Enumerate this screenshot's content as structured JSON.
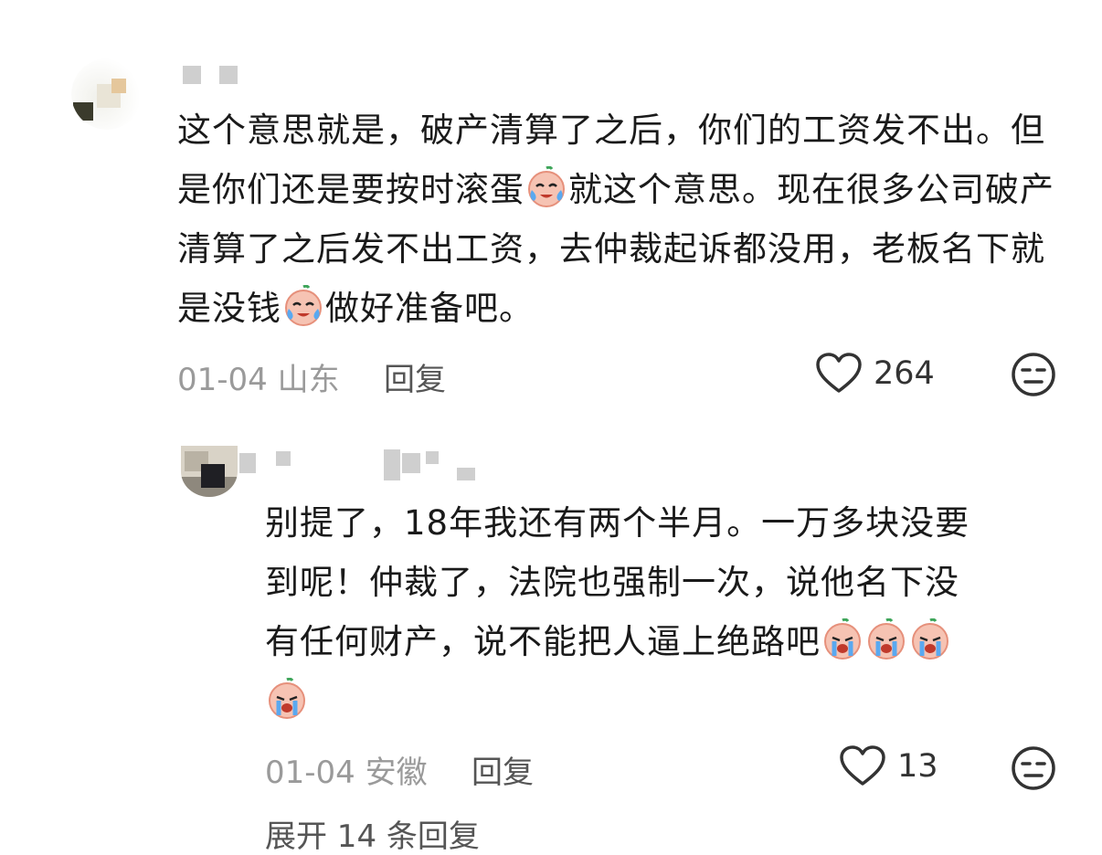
{
  "comment": {
    "text_segments": [
      "这个意思就是，破产清算了之后，你们的工资发不出。但是你们还是要按时滚蛋",
      "就这个意思。现在很多公司破产清算了之后发不出工资，去仲裁起诉都没用，老板名下就是没钱",
      "做好准备吧。"
    ],
    "date": "01-04",
    "location": "山东",
    "reply_label": "回复",
    "like_count": "264",
    "emoji_icon": "crying-face-emoji-icon"
  },
  "reply": {
    "text_line1": "别提了，18年我还有两个半月。一万多块没要",
    "text_line2": "到呢！仲裁了，法院也强制一次，说他名下没",
    "text_line3": "有任何财产，说不能把人逼上绝路吧",
    "date": "01-04",
    "location": "安徽",
    "reply_label": "回复",
    "like_count": "13",
    "emoji_icon": "sobbing-face-emoji-icon"
  },
  "expand_label": "展开 14 条回复",
  "colors": {
    "text": "#1a1a1a",
    "meta": "#9a9a9a",
    "emoji_face": "#f6c3b3",
    "emoji_tear": "#5aa9f0"
  }
}
